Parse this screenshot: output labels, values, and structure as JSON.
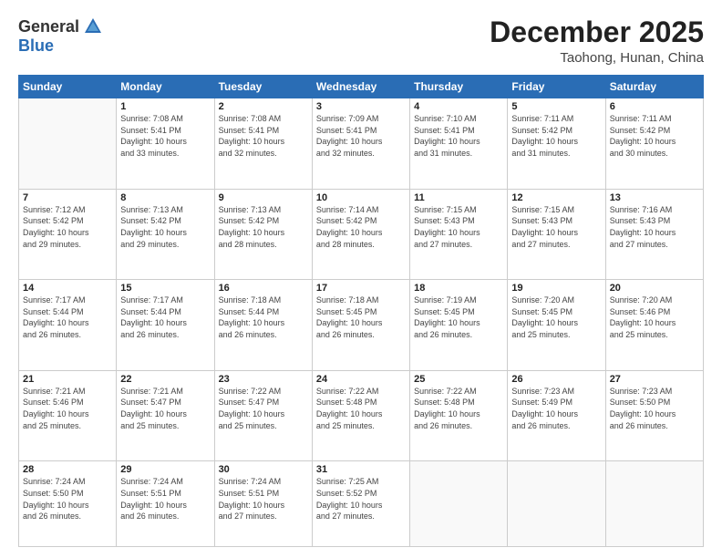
{
  "logo": {
    "general": "General",
    "blue": "Blue"
  },
  "title": "December 2025",
  "location": "Taohong, Hunan, China",
  "days_of_week": [
    "Sunday",
    "Monday",
    "Tuesday",
    "Wednesday",
    "Thursday",
    "Friday",
    "Saturday"
  ],
  "weeks": [
    [
      {
        "day": "",
        "info": ""
      },
      {
        "day": "1",
        "info": "Sunrise: 7:08 AM\nSunset: 5:41 PM\nDaylight: 10 hours\nand 33 minutes."
      },
      {
        "day": "2",
        "info": "Sunrise: 7:08 AM\nSunset: 5:41 PM\nDaylight: 10 hours\nand 32 minutes."
      },
      {
        "day": "3",
        "info": "Sunrise: 7:09 AM\nSunset: 5:41 PM\nDaylight: 10 hours\nand 32 minutes."
      },
      {
        "day": "4",
        "info": "Sunrise: 7:10 AM\nSunset: 5:41 PM\nDaylight: 10 hours\nand 31 minutes."
      },
      {
        "day": "5",
        "info": "Sunrise: 7:11 AM\nSunset: 5:42 PM\nDaylight: 10 hours\nand 31 minutes."
      },
      {
        "day": "6",
        "info": "Sunrise: 7:11 AM\nSunset: 5:42 PM\nDaylight: 10 hours\nand 30 minutes."
      }
    ],
    [
      {
        "day": "7",
        "info": "Sunrise: 7:12 AM\nSunset: 5:42 PM\nDaylight: 10 hours\nand 29 minutes."
      },
      {
        "day": "8",
        "info": "Sunrise: 7:13 AM\nSunset: 5:42 PM\nDaylight: 10 hours\nand 29 minutes."
      },
      {
        "day": "9",
        "info": "Sunrise: 7:13 AM\nSunset: 5:42 PM\nDaylight: 10 hours\nand 28 minutes."
      },
      {
        "day": "10",
        "info": "Sunrise: 7:14 AM\nSunset: 5:42 PM\nDaylight: 10 hours\nand 28 minutes."
      },
      {
        "day": "11",
        "info": "Sunrise: 7:15 AM\nSunset: 5:43 PM\nDaylight: 10 hours\nand 27 minutes."
      },
      {
        "day": "12",
        "info": "Sunrise: 7:15 AM\nSunset: 5:43 PM\nDaylight: 10 hours\nand 27 minutes."
      },
      {
        "day": "13",
        "info": "Sunrise: 7:16 AM\nSunset: 5:43 PM\nDaylight: 10 hours\nand 27 minutes."
      }
    ],
    [
      {
        "day": "14",
        "info": "Sunrise: 7:17 AM\nSunset: 5:44 PM\nDaylight: 10 hours\nand 26 minutes."
      },
      {
        "day": "15",
        "info": "Sunrise: 7:17 AM\nSunset: 5:44 PM\nDaylight: 10 hours\nand 26 minutes."
      },
      {
        "day": "16",
        "info": "Sunrise: 7:18 AM\nSunset: 5:44 PM\nDaylight: 10 hours\nand 26 minutes."
      },
      {
        "day": "17",
        "info": "Sunrise: 7:18 AM\nSunset: 5:45 PM\nDaylight: 10 hours\nand 26 minutes."
      },
      {
        "day": "18",
        "info": "Sunrise: 7:19 AM\nSunset: 5:45 PM\nDaylight: 10 hours\nand 26 minutes."
      },
      {
        "day": "19",
        "info": "Sunrise: 7:20 AM\nSunset: 5:45 PM\nDaylight: 10 hours\nand 25 minutes."
      },
      {
        "day": "20",
        "info": "Sunrise: 7:20 AM\nSunset: 5:46 PM\nDaylight: 10 hours\nand 25 minutes."
      }
    ],
    [
      {
        "day": "21",
        "info": "Sunrise: 7:21 AM\nSunset: 5:46 PM\nDaylight: 10 hours\nand 25 minutes."
      },
      {
        "day": "22",
        "info": "Sunrise: 7:21 AM\nSunset: 5:47 PM\nDaylight: 10 hours\nand 25 minutes."
      },
      {
        "day": "23",
        "info": "Sunrise: 7:22 AM\nSunset: 5:47 PM\nDaylight: 10 hours\nand 25 minutes."
      },
      {
        "day": "24",
        "info": "Sunrise: 7:22 AM\nSunset: 5:48 PM\nDaylight: 10 hours\nand 25 minutes."
      },
      {
        "day": "25",
        "info": "Sunrise: 7:22 AM\nSunset: 5:48 PM\nDaylight: 10 hours\nand 26 minutes."
      },
      {
        "day": "26",
        "info": "Sunrise: 7:23 AM\nSunset: 5:49 PM\nDaylight: 10 hours\nand 26 minutes."
      },
      {
        "day": "27",
        "info": "Sunrise: 7:23 AM\nSunset: 5:50 PM\nDaylight: 10 hours\nand 26 minutes."
      }
    ],
    [
      {
        "day": "28",
        "info": "Sunrise: 7:24 AM\nSunset: 5:50 PM\nDaylight: 10 hours\nand 26 minutes."
      },
      {
        "day": "29",
        "info": "Sunrise: 7:24 AM\nSunset: 5:51 PM\nDaylight: 10 hours\nand 26 minutes."
      },
      {
        "day": "30",
        "info": "Sunrise: 7:24 AM\nSunset: 5:51 PM\nDaylight: 10 hours\nand 27 minutes."
      },
      {
        "day": "31",
        "info": "Sunrise: 7:25 AM\nSunset: 5:52 PM\nDaylight: 10 hours\nand 27 minutes."
      },
      {
        "day": "",
        "info": ""
      },
      {
        "day": "",
        "info": ""
      },
      {
        "day": "",
        "info": ""
      }
    ]
  ]
}
